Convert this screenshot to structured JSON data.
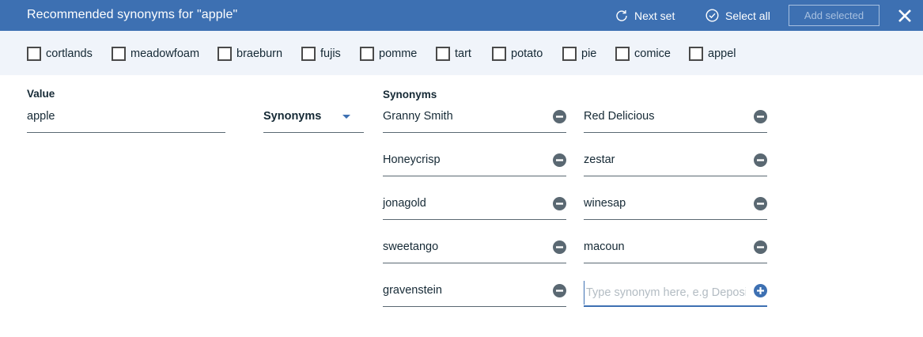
{
  "header": {
    "title": "Recommended synonyms for \"apple\"",
    "next_set_label": "Next set",
    "select_all_label": "Select all",
    "add_selected_label": "Add selected"
  },
  "recommendations": [
    "cortlands",
    "meadowfoam",
    "braeburn",
    "fujis",
    "pomme",
    "tart",
    "potato",
    "pie",
    "comice",
    "appel"
  ],
  "form": {
    "value_label": "Value",
    "value": "apple",
    "type_value": "Synonyms",
    "synonyms_label": "Synonyms",
    "synonyms": [
      "Granny Smith",
      "Red Delicious",
      "Honeycrisp",
      "zestar",
      "jonagold",
      "winesap",
      "sweetango",
      "macoun",
      "gravenstein"
    ],
    "new_synonym_placeholder": "Type synonym here, e.g Deposit"
  },
  "colors": {
    "header_bg": "#3d70b2",
    "strip_bg": "#f0f4fa",
    "accent": "#3d70b2",
    "remove_icon": "#5a6872"
  },
  "icons": {
    "next_set": "refresh-icon",
    "select_all": "check-circle-icon",
    "close": "close-icon",
    "remove": "minus-circle-icon",
    "add": "plus-circle-icon",
    "dropdown": "caret-down-icon"
  }
}
